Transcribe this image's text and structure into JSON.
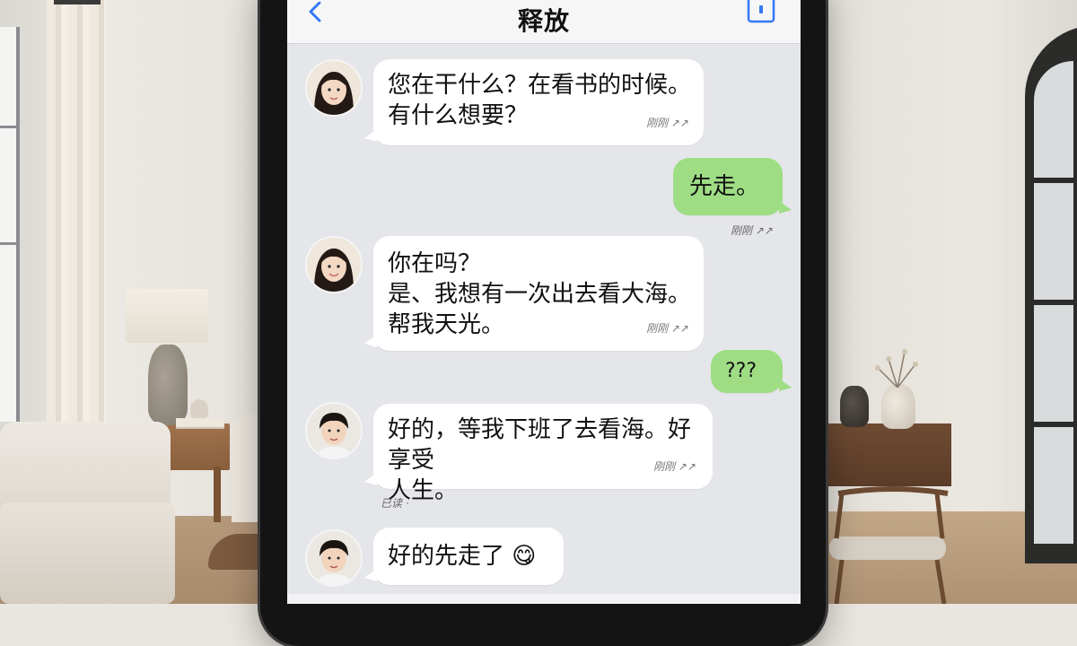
{
  "header": {
    "title": "释放",
    "back_icon": "chevron-left-icon",
    "info_icon": "contact-card-icon"
  },
  "colors": {
    "accent": "#3478f6",
    "incoming_bubble": "#ffffff",
    "outgoing_bubble": "#9edd84",
    "chat_background": "#e5e6ea"
  },
  "messages": [
    {
      "side": "incoming",
      "avatar": "girl-avatar",
      "text": "您在干什么？在看书的时候。\n有什么想要？",
      "time": "刚刚 ↗↗"
    },
    {
      "side": "outgoing",
      "text": "先走。",
      "time": "刚刚 ↗↗"
    },
    {
      "side": "incoming",
      "avatar": "girl-avatar",
      "text": "你在吗？\n是、我想有一次出去看大海。\n帮我天光。",
      "time": "刚刚 ↗↗"
    },
    {
      "side": "outgoing",
      "text": "???"
    },
    {
      "side": "incoming",
      "avatar": "boy-avatar",
      "text": "好的，等我下班了去看海。好享受\n人生。",
      "time": "刚刚 ↗↗",
      "footer": "已读 ·"
    },
    {
      "side": "incoming",
      "avatar": "boy-avatar",
      "text": "好的先走了 😋"
    }
  ]
}
